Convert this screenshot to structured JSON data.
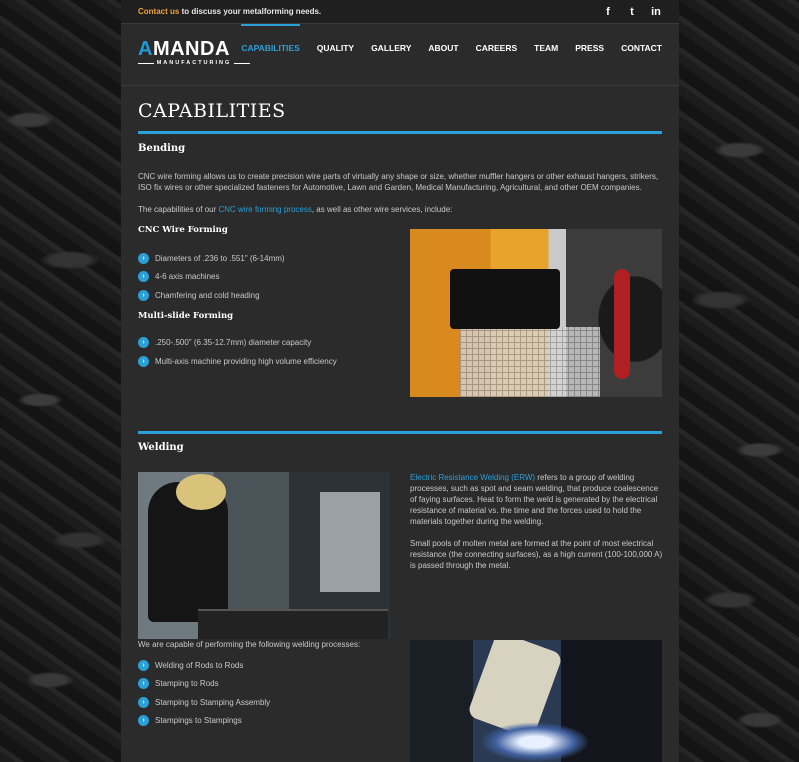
{
  "topbar": {
    "contact_link": "Contact us",
    "contact_text": " to discuss your metalforming needs.",
    "social": [
      {
        "icon": "facebook-icon",
        "glyph": "f"
      },
      {
        "icon": "twitter-icon",
        "glyph": "t"
      },
      {
        "icon": "linkedin-icon",
        "glyph": "in"
      }
    ]
  },
  "logo": {
    "word_a": "A",
    "word_rest": "MANDA",
    "sub": "MANUFACTURING"
  },
  "nav": {
    "items": [
      "CAPABILITIES",
      "QUALITY",
      "GALLERY",
      "ABOUT",
      "CAREERS",
      "TEAM",
      "PRESS",
      "CONTACT"
    ],
    "active": "CAPABILITIES"
  },
  "page_title": "CAPABILITIES",
  "bending": {
    "heading": "Bending",
    "intro": "CNC wire forming allows us to create precision wire parts of virtually any shape or size, whether muffler hangers or other exhaust hangers, strikers, ISO fix wires or other specialized fasteners for Automotive, Lawn and Garden, Medical Manufacturing, Agricultural, and other OEM companies.",
    "cap_pre": "The capabilities of our ",
    "cap_link": "CNC wire forming process",
    "cap_post": ", as well as other wire services, include:",
    "cnc_heading": "CNC Wire Forming",
    "cnc_items": [
      "Diameters of .236 to .551\" (6-14mm)",
      "4-6 axis machines",
      "Chamfering and cold heading"
    ],
    "multi_heading": "Multi-slide Forming",
    "multi_items": [
      ".250-.500\" (6.35-12.7mm) diameter capacity",
      "Multi-axis machine providing high volume efficiency"
    ]
  },
  "welding": {
    "heading": "Welding",
    "erw_link": "Electric Resistance Welding (ERW)",
    "erw_text": " refers to a group of welding processes, such as spot and seam welding, that produce coalescence of faying surfaces. Heat to form the weld is generated by the electrical resistance of material vs. the time and the forces used to hold the materials together during the welding.",
    "pools_text": "Small pools of molten metal are formed at the point of most electrical resistance (the connecting surfaces), as a high current (100-100,000 A) is passed through the metal.",
    "capable_text": "We are capable of performing the following welding processes:",
    "items": [
      "Welding of Rods to Rods",
      "Stamping to Rods",
      "Stamping to Stamping Assembly",
      "Stampings to Stampings"
    ]
  },
  "colors": {
    "accent": "#2a9fd8",
    "contact_link": "#f0a23a",
    "panel": "#2b2b2b"
  }
}
